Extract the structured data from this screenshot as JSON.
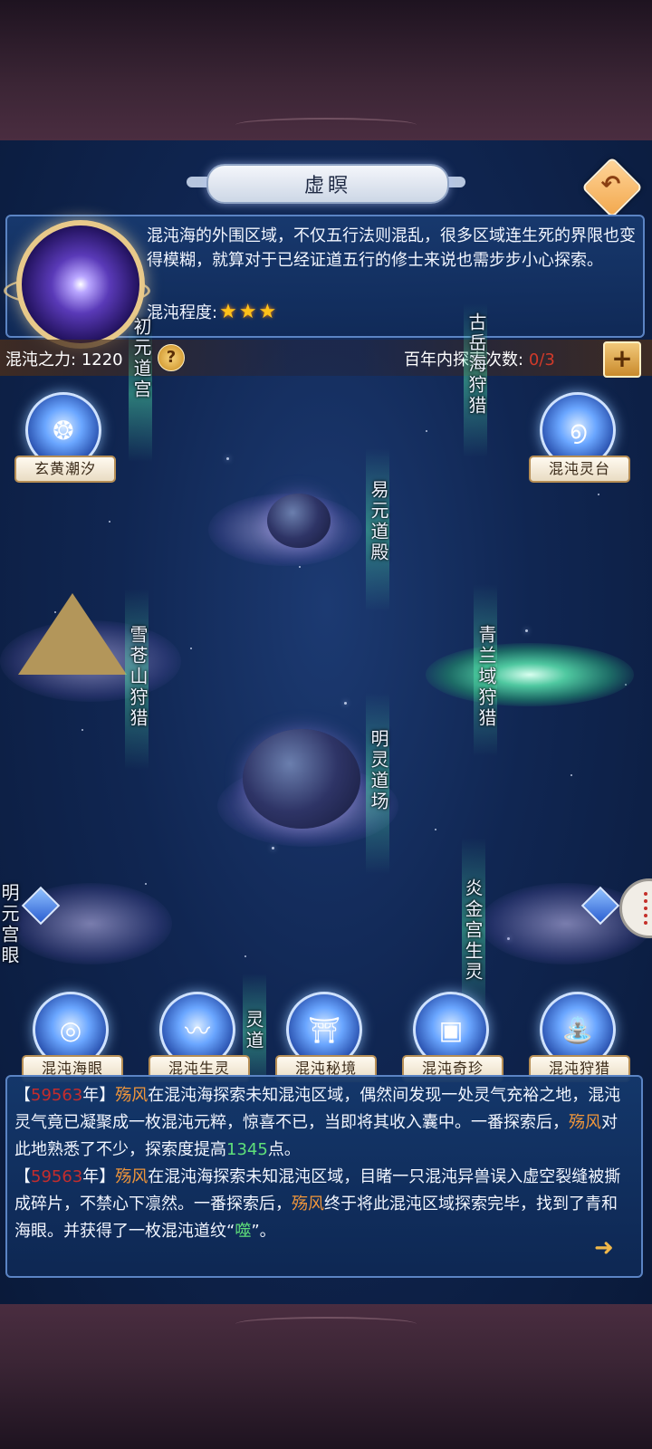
{
  "header": {
    "title": "虚瞑"
  },
  "info": {
    "description": "混沌海的外围区域，不仅五行法则混乱，很多区域连生死的界限也变得模糊，就算对于已经证道五行的修士来说也需步步小心探索。",
    "chaos_level_label": "混沌程度:",
    "chaos_stars": 3
  },
  "stats": {
    "power_label": "混沌之力:",
    "power_value": "1220",
    "help_icon": "?",
    "explore_label": "百年内探索次数:",
    "explore_count": "0/3",
    "plus_icon": "+"
  },
  "map": {
    "locations": [
      {
        "label": "初元道宫"
      },
      {
        "label": "古岳海狩猎"
      },
      {
        "label": "易元道殿"
      },
      {
        "label": "雪苍山狩猎"
      },
      {
        "label": "青兰域狩猎"
      },
      {
        "label": "明灵道场"
      },
      {
        "label": "炎金宫生灵"
      },
      {
        "label": "明元宫眼"
      },
      {
        "label": "灵道"
      }
    ],
    "top_nodes": [
      {
        "label": "玄黄潮汐"
      },
      {
        "label": "混沌灵台"
      }
    ],
    "bottom_nodes": [
      {
        "label": "混沌海眼"
      },
      {
        "label": "混沌生灵"
      },
      {
        "label": "混沌秘境"
      },
      {
        "label": "混沌奇珍"
      },
      {
        "label": "混沌狩猎"
      }
    ]
  },
  "log": {
    "e1_open": "【",
    "e1_year": "59563",
    "e1_year_suffix": "年】",
    "e1_name": "殇风",
    "e1_text1": "在混沌海探索未知混沌区域，偶然间发现一处灵气充裕之地，混沌灵气竟已凝聚成一枚混沌元粹，惊喜不已，当即将其收入囊中。一番探索后，",
    "e1_name2": "殇风",
    "e1_text2": "对此地熟悉了不少，探索度提高",
    "e1_points": "1345",
    "e1_text3": "点。",
    "e2_open": "【",
    "e2_year": "59563",
    "e2_year_suffix": "年】",
    "e2_name": "殇风",
    "e2_text1": "在混沌海探索未知混沌区域，目睹一只混沌异兽误入虚空裂缝被撕成碎片，不禁心下凛然。一番探索后，",
    "e2_name2": "殇风",
    "e2_text2": "终于将此混沌区域探索完毕，找到了青和海眼。并获得了一枚混沌道纹",
    "e2_quote_open": "“",
    "e2_item": "噬",
    "e2_quote_close": "”。"
  }
}
